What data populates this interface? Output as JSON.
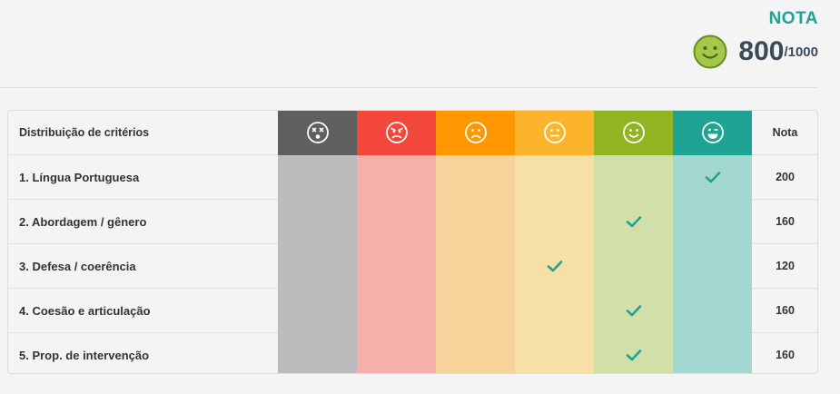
{
  "header": {
    "title": "NOTA",
    "score": "800",
    "max": "/1000"
  },
  "table": {
    "criteria_header": "Distribuição de critérios",
    "score_header": "Nota",
    "levels": [
      {
        "icon": "dizzy-face-icon",
        "header_color": "#5f5f5f",
        "cell_color": "#bcbcbc"
      },
      {
        "icon": "angry-face-icon",
        "header_color": "#f2473a",
        "cell_color": "#f4b0aa"
      },
      {
        "icon": "sad-face-icon",
        "header_color": "#ff9800",
        "cell_color": "#f8d49c"
      },
      {
        "icon": "neutral-face-icon",
        "header_color": "#fbb42b",
        "cell_color": "#f7e0a8"
      },
      {
        "icon": "smile-face-icon",
        "header_color": "#90b521",
        "cell_color": "#d1e0a8"
      },
      {
        "icon": "grin-face-icon",
        "header_color": "#1fa394",
        "cell_color": "#a3d8d1"
      }
    ],
    "check_color": "#1fa394",
    "rows": [
      {
        "label": "1. Língua Portuguesa",
        "level": 5,
        "score": "200"
      },
      {
        "label": "2. Abordagem / gênero",
        "level": 4,
        "score": "160"
      },
      {
        "label": "3. Defesa / coerência",
        "level": 3,
        "score": "120"
      },
      {
        "label": "4. Coesão e articulação",
        "level": 4,
        "score": "160"
      },
      {
        "label": "5. Prop. de intervenção",
        "level": 4,
        "score": "160"
      }
    ]
  }
}
